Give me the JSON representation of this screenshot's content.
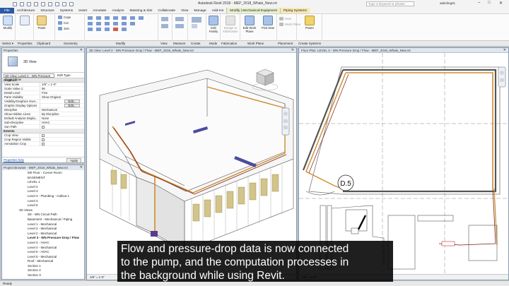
{
  "titlebar": {
    "app_title": "Autodesk Revit 2018 -    MEP_2018_Whats_New.rvt",
    "search_placeholder": "Type a keyword or phrase",
    "user": "adierling01"
  },
  "tabs": [
    "File",
    "Architecture",
    "Structure",
    "Systems",
    "Insert",
    "Annotate",
    "Analyze",
    "Massing & Site",
    "Collaborate",
    "View",
    "Manage",
    "Add-Ins",
    "Modify | Mechanical Equipment",
    "Piping Systems"
  ],
  "ribbon": {
    "modify_label": "Modify",
    "paste_label": "Paste",
    "cope_label": "Cope",
    "cut_label": "Cut",
    "join_label": "Join",
    "panels": {
      "select": "Select",
      "properties": "Properties",
      "clipboard": "Clipboard",
      "geometry": "Geometry",
      "modify": "Modify",
      "view": "View",
      "measure": "Measure",
      "create": "Create",
      "mode": "Mode",
      "fabrication": "Fabrication",
      "work_plane": "Work Plane",
      "placement": "Placement",
      "create_systems": "Create Systems"
    },
    "buttons": {
      "edit_family": "Edit Family",
      "design_fabrication": "Design to Fabrication",
      "edit_work_plane": "Edit Work Plane",
      "pick_new": "Pick New",
      "host": "Host",
      "work_plane": "Work Plane",
      "power": "Power"
    }
  },
  "selectbar": {
    "select": "Select ▾",
    "properties": "Properties"
  },
  "properties": {
    "title": "Properties",
    "type_name": "3D View",
    "view_selector": "3D View: Level 2 - WN Pressure Drop / Flow",
    "edit_type": "Edit Type",
    "graphics_cat": "Graphics",
    "rows": [
      {
        "k": "View Scale",
        "v": "1/8\" = 1'-0\""
      },
      {
        "k": "Scale Value    1:",
        "v": "96"
      },
      {
        "k": "Detail Level",
        "v": "Fine"
      },
      {
        "k": "Parts Visibility",
        "v": "Show Original"
      },
      {
        "k": "Visibility/Graphics Over...",
        "v": "",
        "btn": "Edit..."
      },
      {
        "k": "Graphic Display Options",
        "v": "",
        "btn": "Edit..."
      },
      {
        "k": "Discipline",
        "v": "Mechanical"
      },
      {
        "k": "Show Hidden Lines",
        "v": "By Discipline"
      },
      {
        "k": "Default Analysis Displa...",
        "v": "None"
      },
      {
        "k": "Sub-Discipline",
        "v": "HVAC"
      },
      {
        "k": "Sun Path",
        "v": "",
        "check": true
      }
    ],
    "extents_cat": "Extents",
    "extents_rows": [
      {
        "k": "Crop View",
        "v": "",
        "check": true
      },
      {
        "k": "Crop Region Visible",
        "v": "",
        "check": true
      },
      {
        "k": "Annotation Crop",
        "v": "",
        "check": true
      }
    ],
    "help_link": "Properties help",
    "apply": "Apply"
  },
  "browser": {
    "title": "Project Browser - MEP_2018_Whats_New.rvt",
    "items": [
      {
        "t": "5th Floor - Corner Room",
        "d": 3
      },
      {
        "t": "BASEMENT",
        "d": 3
      },
      {
        "t": "LEVEL 1",
        "d": 3
      },
      {
        "t": "Level 2",
        "d": 3
      },
      {
        "t": "Level 3",
        "d": 3
      },
      {
        "t": "Level 3 - Plumbing - Callout 1",
        "d": 3
      },
      {
        "t": "Level 4",
        "d": 3
      },
      {
        "t": "Level 5",
        "d": 3
      },
      {
        "t": "3D Views",
        "d": 2
      },
      {
        "t": "3D - WN Circuit Path",
        "d": 3
      },
      {
        "t": "Basement - Mechanical / Piping",
        "d": 3
      },
      {
        "t": "Level 1 - Mechanical",
        "d": 3
      },
      {
        "t": "Level 2 - Mechanical",
        "d": 3
      },
      {
        "t": "Level 2 - Mechanical",
        "d": 3
      },
      {
        "t": "Level 3 - WN Pressure Drop / Flow",
        "d": 3,
        "b": true
      },
      {
        "t": "Level 4 - HVAC",
        "d": 3
      },
      {
        "t": "Level 4 - Mechanical",
        "d": 3
      },
      {
        "t": "Level 5 - HVAC",
        "d": 3
      },
      {
        "t": "Level 5 - Mechanical",
        "d": 3
      },
      {
        "t": "Roof - Mechanical",
        "d": 3
      },
      {
        "t": "Section 1",
        "d": 3
      },
      {
        "t": "Section 2",
        "d": 3
      },
      {
        "t": "Section 3",
        "d": 3
      }
    ]
  },
  "view3d": {
    "title": "3D View: Level 2 - WN Pressure Drop / Flow - MEP_2018_Whats_New.rvt",
    "scale": "1/8\" = 1'-0\""
  },
  "plan": {
    "title": "Floor Plan: LEVEL 3 - WN Pressure Drop / Flow - MEP_2018_Whats_New.rvt",
    "grid_tag": "D.5",
    "scale": "1/8\" = 1'-0\""
  },
  "status": {
    "ready": "Ready"
  },
  "caption": {
    "line1": "Flow and pressure-drop data is now connected",
    "line2": "to the pump, and the computation processes in",
    "line3": "the background while using Revit."
  },
  "colors": {
    "file_tab": "#2a5aa8",
    "pipe": "#d08a2c",
    "pipe_dark": "#7a1e10",
    "caption_bg": "#000000"
  }
}
